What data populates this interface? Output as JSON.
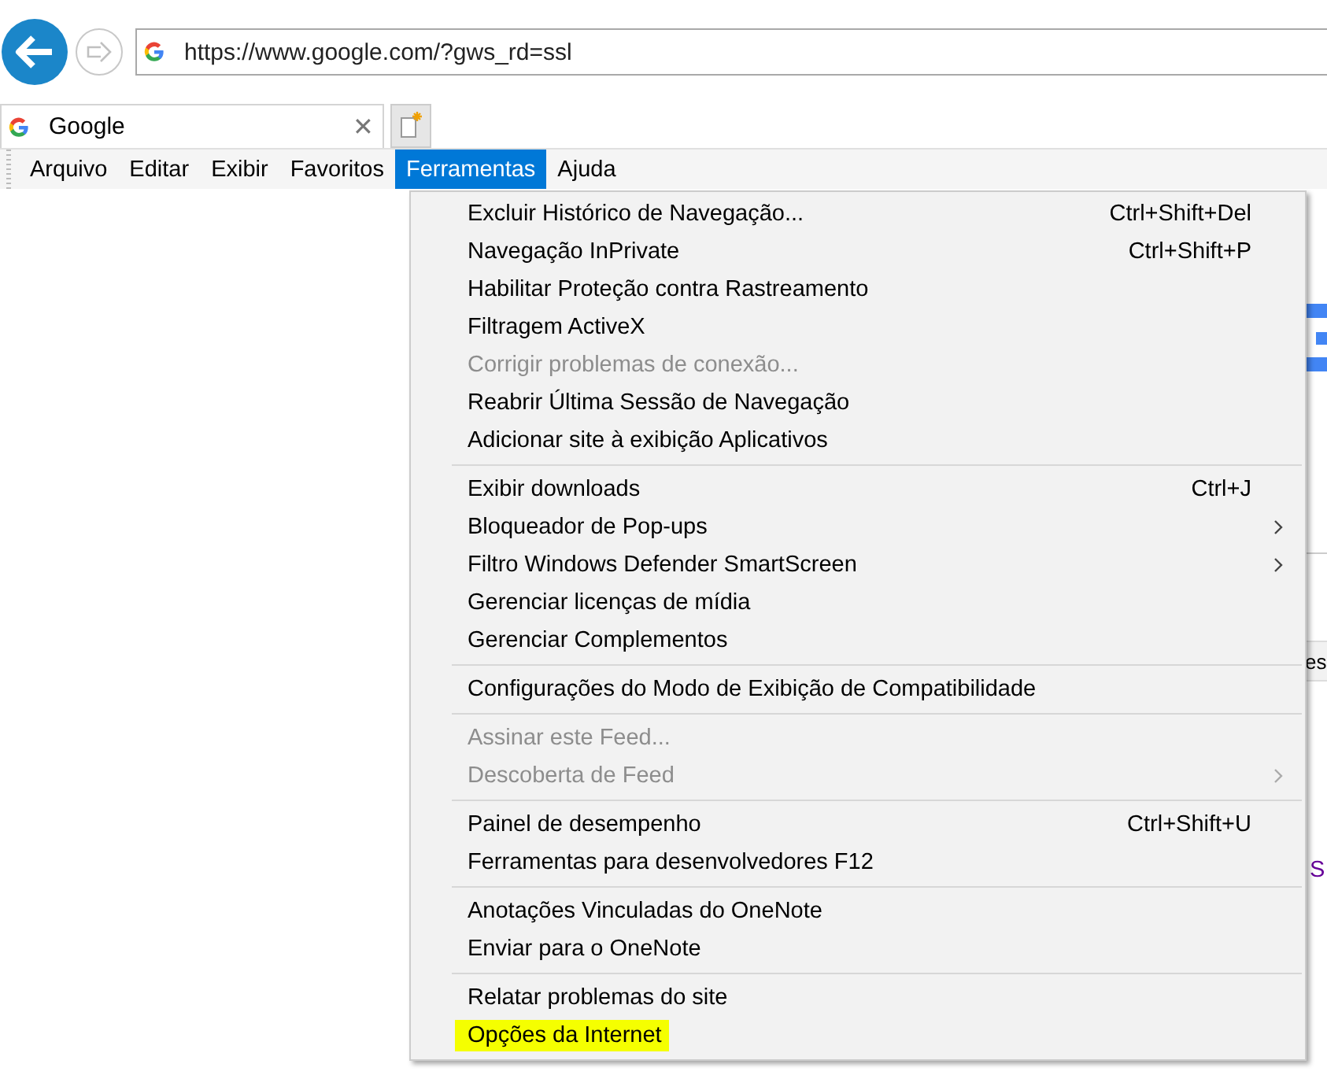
{
  "address_bar": {
    "url": "https://www.google.com/?gws_rd=ssl"
  },
  "tabs": [
    {
      "title": "Google",
      "close": "✕",
      "selected": true
    }
  ],
  "menu_bar": [
    {
      "label": "Arquivo",
      "selected": false
    },
    {
      "label": "Editar",
      "selected": false
    },
    {
      "label": "Exibir",
      "selected": false
    },
    {
      "label": "Favoritos",
      "selected": false
    },
    {
      "label": "Ferramentas",
      "selected": true
    },
    {
      "label": "Ajuda",
      "selected": false
    }
  ],
  "menu_groups": [
    [
      {
        "label": "Excluir Histórico de Navegação...",
        "shortcut": "Ctrl+Shift+Del",
        "submenu": false,
        "disabled": false,
        "highlighted": false
      },
      {
        "label": "Navegação InPrivate",
        "shortcut": "Ctrl+Shift+P",
        "submenu": false,
        "disabled": false,
        "highlighted": false
      },
      {
        "label": "Habilitar Proteção contra Rastreamento",
        "submenu": false,
        "disabled": false,
        "highlighted": false
      },
      {
        "label": "Filtragem ActiveX",
        "submenu": false,
        "disabled": false,
        "highlighted": false
      },
      {
        "label": "Corrigir problemas de conexão...",
        "submenu": false,
        "disabled": true,
        "highlighted": false
      },
      {
        "label": "Reabrir Última Sessão de Navegação",
        "submenu": false,
        "disabled": false,
        "highlighted": false
      },
      {
        "label": "Adicionar site à exibição Aplicativos",
        "submenu": false,
        "disabled": false,
        "highlighted": false
      }
    ],
    [
      {
        "label": "Exibir downloads",
        "shortcut": "Ctrl+J",
        "submenu": false,
        "disabled": false,
        "highlighted": false
      },
      {
        "label": "Bloqueador de Pop-ups",
        "submenu": true,
        "disabled": false,
        "highlighted": false
      },
      {
        "label": "Filtro Windows Defender SmartScreen",
        "submenu": true,
        "disabled": false,
        "highlighted": false
      },
      {
        "label": "Gerenciar licenças de mídia",
        "submenu": false,
        "disabled": false,
        "highlighted": false
      },
      {
        "label": "Gerenciar Complementos",
        "submenu": false,
        "disabled": false,
        "highlighted": false
      }
    ],
    [
      {
        "label": "Configurações do Modo de Exibição de Compatibilidade",
        "submenu": false,
        "disabled": false,
        "highlighted": false
      }
    ],
    [
      {
        "label": "Assinar este Feed...",
        "submenu": false,
        "disabled": true,
        "highlighted": false
      },
      {
        "label": "Descoberta de Feed",
        "submenu": true,
        "disabled": true,
        "highlighted": false
      }
    ],
    [
      {
        "label": "Painel de desempenho",
        "shortcut": "Ctrl+Shift+U",
        "submenu": false,
        "disabled": false,
        "highlighted": false
      },
      {
        "label": "Ferramentas para desenvolvedores F12",
        "submenu": false,
        "disabled": false,
        "highlighted": false
      }
    ],
    [
      {
        "label": "Anotações Vinculadas do OneNote",
        "submenu": false,
        "disabled": false,
        "highlighted": false
      },
      {
        "label": "Enviar para o OneNote",
        "submenu": false,
        "disabled": false,
        "highlighted": false
      }
    ],
    [
      {
        "label": "Relatar problemas do site",
        "submenu": false,
        "disabled": false,
        "highlighted": false
      },
      {
        "label": "Opções da Internet",
        "submenu": false,
        "disabled": false,
        "highlighted": true
      }
    ]
  ],
  "page_behind": {
    "button_fragment": "es",
    "link_fragment": "S"
  }
}
